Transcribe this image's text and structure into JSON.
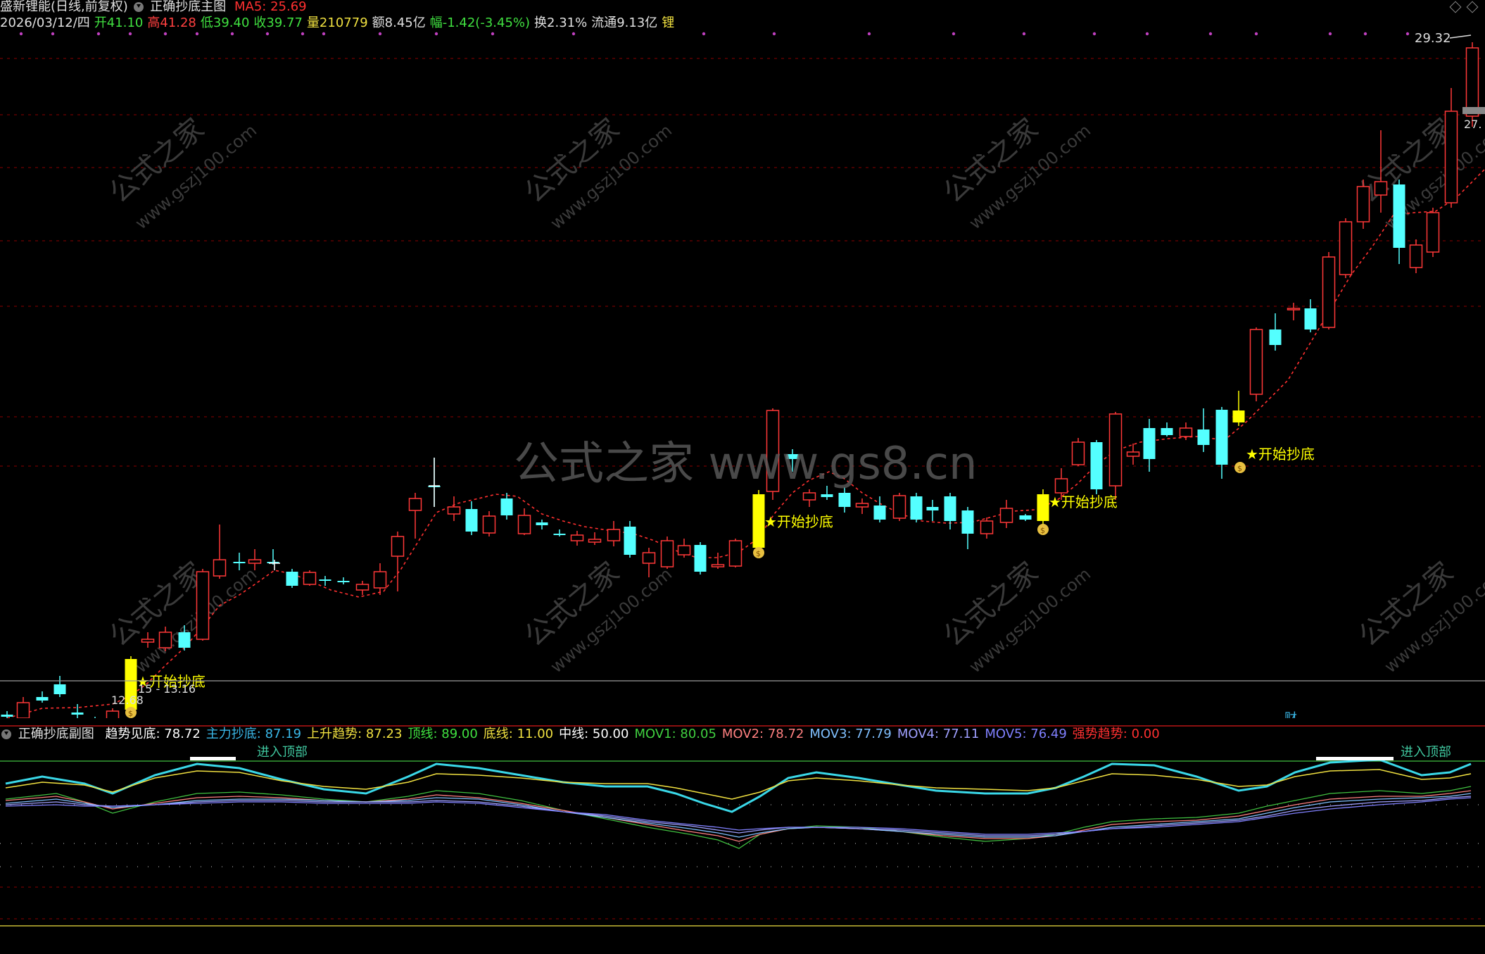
{
  "header": {
    "stock_title": "盛新锂能(日线,前复权)",
    "indicator_main": "正确抄底主图",
    "ma5_label": "MA5: 25.69"
  },
  "quote": {
    "date": "2026/03/12/四",
    "open": "开41.10",
    "high": "高41.28",
    "low": "低39.40",
    "close": "收39.77",
    "volume": "量210779",
    "amount": "额8.45亿",
    "change": "幅-1.42(-3.45%)",
    "turnover": "换2.31%",
    "float": "流通9.13亿",
    "tag": "锂"
  },
  "main_chart": {
    "price_high_label": "29.32",
    "price_right_label": "27.",
    "low_label": "12.68",
    "low_range_label": "15 - 13.16",
    "signal_label": "★开始抄底",
    "cai_label": "财",
    "watermark_big": "公式之家 www.gs8.cn",
    "watermark_small_cn": "公式之家",
    "watermark_small_url": "www.gszj100.com"
  },
  "sub_chart": {
    "title": "正确抄底副图",
    "items": [
      {
        "label": "趋势见底:",
        "value": "78.72",
        "color": "#ffffff"
      },
      {
        "label": "主力抄底:",
        "value": "87.19",
        "color": "#3ab8e8"
      },
      {
        "label": "上升趋势:",
        "value": "87.23",
        "color": "#f0e040"
      },
      {
        "label": "顶线:",
        "value": "89.00",
        "color": "#40e040"
      },
      {
        "label": "底线:",
        "value": "11.00",
        "color": "#f0e040"
      },
      {
        "label": "中线:",
        "value": "50.00",
        "color": "#ffffff"
      },
      {
        "label": "MOV1:",
        "value": "80.05",
        "color": "#40d040"
      },
      {
        "label": "MOV2:",
        "value": "78.72",
        "color": "#ff8080"
      },
      {
        "label": "MOV3:",
        "value": "77.79",
        "color": "#80c0ff"
      },
      {
        "label": "MOV4:",
        "value": "77.11",
        "color": "#a0a0ff"
      },
      {
        "label": "MOV5:",
        "value": "76.49",
        "color": "#8080ff"
      },
      {
        "label": "强势趋势:",
        "value": "0.00",
        "color": "#ff3030"
      }
    ],
    "top_zone_label": "进入顶部"
  },
  "colors": {
    "up": "#ff3838",
    "down": "#54ffff",
    "signal": "#ffff00",
    "ma": "#ff3030",
    "grid": "#8b0000"
  }
}
